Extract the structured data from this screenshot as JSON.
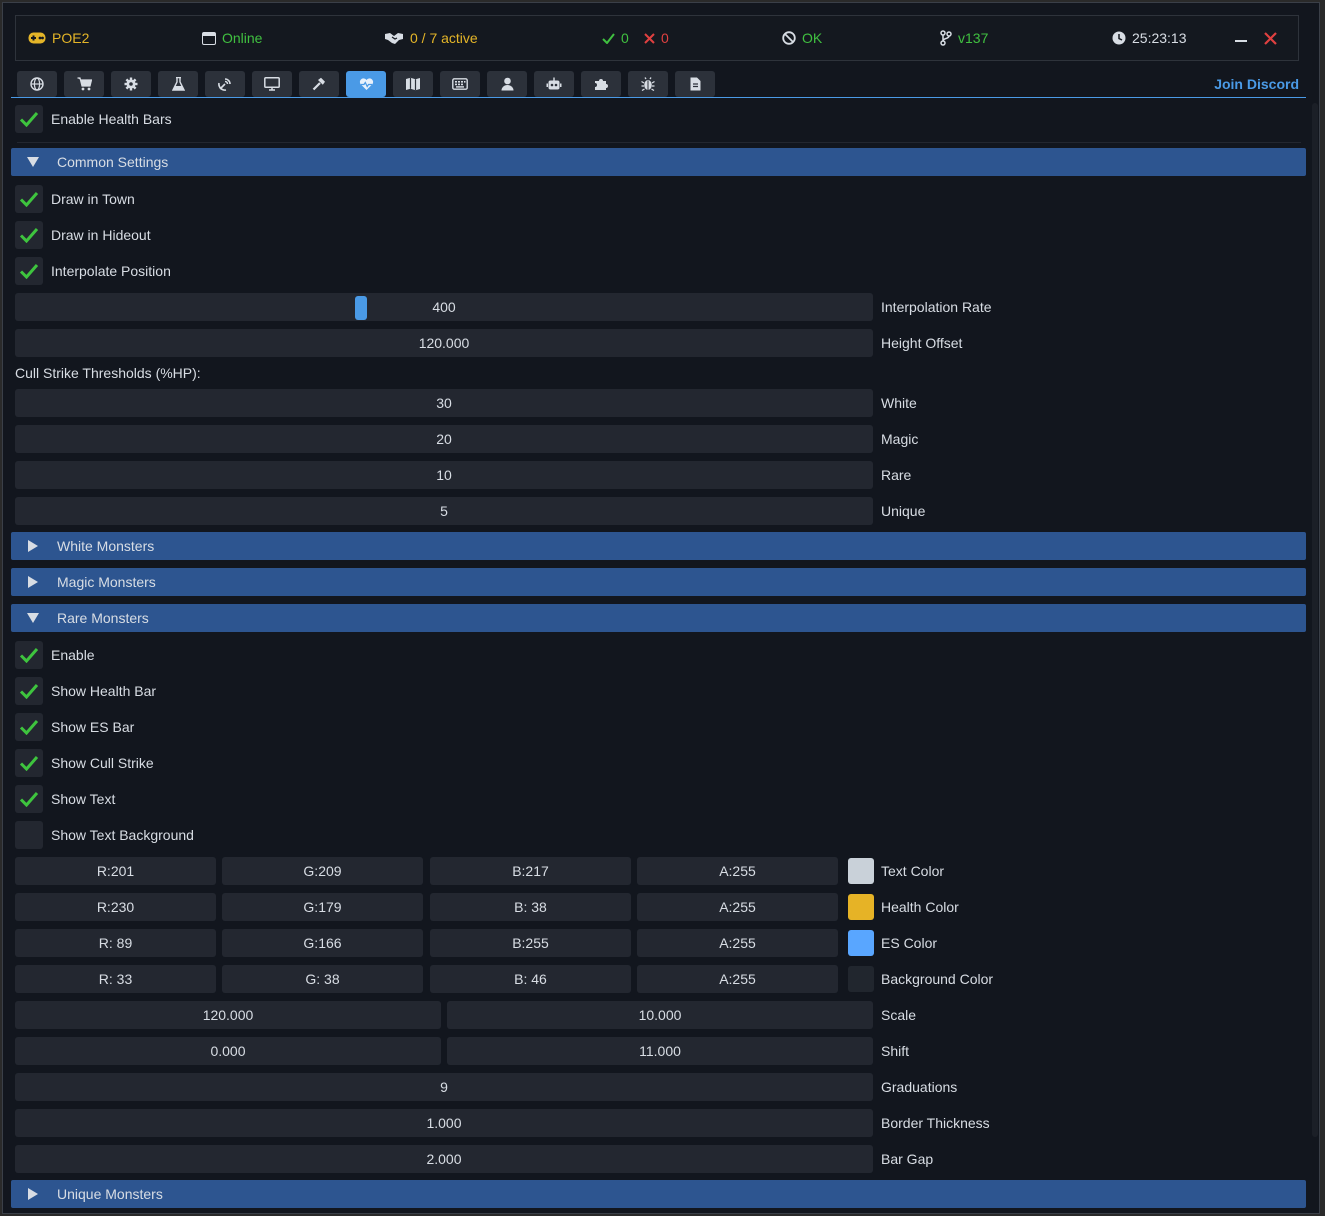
{
  "status": {
    "game": "POE2",
    "connection": "Online",
    "active": "0 / 7 active",
    "ok_count": "0",
    "err_count": "0",
    "health": "OK",
    "version": "v137",
    "clock": "25:23:13"
  },
  "tabs": [
    "globe-icon",
    "cart-icon",
    "gear-icon",
    "flask-icon",
    "radar-icon",
    "monitor-icon",
    "hammer-icon",
    "heart-icon",
    "map-icon",
    "keyboard-icon",
    "user-icon",
    "robot-icon",
    "puzzle-icon",
    "bug-icon",
    "file-icon"
  ],
  "active_tab": "heart-icon",
  "join_discord": "Join Discord",
  "enable_health_bars": "Enable Health Bars",
  "common": {
    "title": "Common Settings",
    "draw_in_town": "Draw in Town",
    "draw_in_hideout": "Draw in Hideout",
    "interpolate_position": "Interpolate Position",
    "interpolation_rate": {
      "value": "400",
      "label": "Interpolation Rate",
      "fraction": 0.4
    },
    "height_offset": {
      "value": "120.000",
      "label": "Height Offset"
    },
    "cull_title": "Cull Strike Thresholds (%HP):",
    "cull": [
      {
        "value": "30",
        "label": "White"
      },
      {
        "value": "20",
        "label": "Magic"
      },
      {
        "value": "10",
        "label": "Rare"
      },
      {
        "value": "5",
        "label": "Unique"
      }
    ]
  },
  "sections": {
    "white": "White Monsters",
    "magic": "Magic Monsters",
    "rare": "Rare Monsters",
    "unique": "Unique Monsters"
  },
  "rare": {
    "checks": [
      {
        "label": "Enable",
        "checked": true
      },
      {
        "label": "Show Health Bar",
        "checked": true
      },
      {
        "label": "Show ES Bar",
        "checked": true
      },
      {
        "label": "Show Cull Strike",
        "checked": true
      },
      {
        "label": "Show Text",
        "checked": true
      },
      {
        "label": "Show Text Background",
        "checked": false
      }
    ],
    "colors": [
      {
        "r": "R:201",
        "g": "G:209",
        "b": "B:217",
        "a": "A:255",
        "swatch": "#c9d1d9",
        "label": "Text Color"
      },
      {
        "r": "R:230",
        "g": "G:179",
        "b": "B: 38",
        "a": "A:255",
        "swatch": "#e6b326",
        "label": "Health Color"
      },
      {
        "r": "R: 89",
        "g": "G:166",
        "b": "B:255",
        "a": "A:255",
        "swatch": "#59a6ff",
        "label": "ES Color"
      },
      {
        "r": "R: 33",
        "g": "G: 38",
        "b": "B: 46",
        "a": "A:255",
        "swatch": "#21262e",
        "label": "Background Color"
      }
    ],
    "scale": {
      "a": "120.000",
      "b": "10.000",
      "label": "Scale"
    },
    "shift": {
      "a": "0.000",
      "b": "11.000",
      "label": "Shift"
    },
    "graduations": {
      "value": "9",
      "label": "Graduations"
    },
    "border_thickness": {
      "value": "1.000",
      "label": "Border Thickness"
    },
    "bar_gap": {
      "value": "2.000",
      "label": "Bar Gap"
    }
  },
  "colors": {
    "accent": "#4a9ae6",
    "header": "#2d5590",
    "check": "#3ec43e",
    "warn": "#e4b528",
    "error": "#e04040"
  }
}
